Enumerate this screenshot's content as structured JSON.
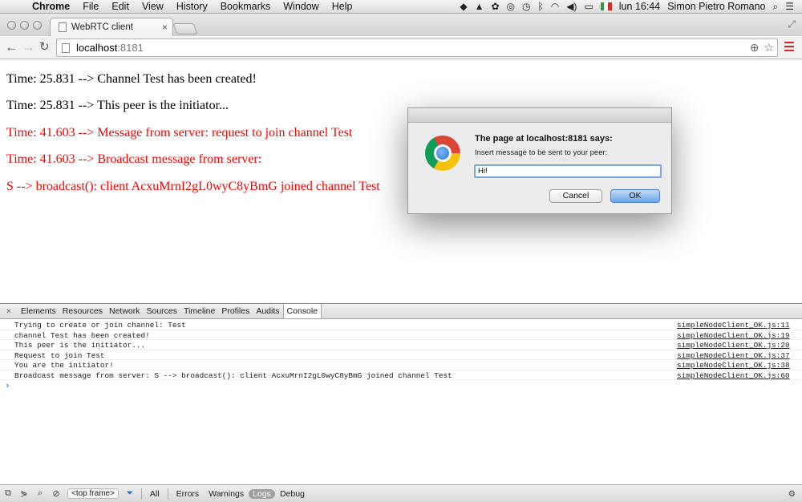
{
  "menubar": {
    "items": [
      "Chrome",
      "File",
      "Edit",
      "View",
      "History",
      "Bookmarks",
      "Window",
      "Help"
    ],
    "clock": "lun 16:44",
    "user": "Simon Pietro Romano"
  },
  "browser": {
    "tab_title": "WebRTC client",
    "url_host": "localhost",
    "url_port": ":8181"
  },
  "page": {
    "lines": [
      {
        "text": "Time: 25.831 --> Channel Test has been created!",
        "color": "#000000"
      },
      {
        "text": "Time: 25.831 --> This peer is the initiator...",
        "color": "#000000"
      },
      {
        "text": "Time: 41.603 --> Message from server: request to join channel Test",
        "color": "#ff0000"
      },
      {
        "text": "Time: 41.603 --> Broadcast message from server:",
        "color": "#ff0000"
      },
      {
        "text": "S --> broadcast(): client AcxuMrnI2gL0wyC8yBmG joined channel Test",
        "color": "#ff0000"
      }
    ]
  },
  "dialog": {
    "title": "The page at localhost:8181 says:",
    "message": "Insert message to be sent to your peer:",
    "input_value": "Hi!",
    "cancel_label": "Cancel",
    "ok_label": "OK"
  },
  "devtools": {
    "tabs": [
      "Elements",
      "Resources",
      "Network",
      "Sources",
      "Timeline",
      "Profiles",
      "Audits",
      "Console"
    ],
    "active_tab": "Console",
    "console_rows": [
      {
        "message": "Trying to create or join channel:  Test",
        "source": "simpleNodeClient_OK.js:11"
      },
      {
        "message": "channel Test has been created!",
        "source": "simpleNodeClient_OK.js:19"
      },
      {
        "message": "This peer is the initiator...",
        "source": "simpleNodeClient_OK.js:20"
      },
      {
        "message": "Request to join Test",
        "source": "simpleNodeClient_OK.js:37"
      },
      {
        "message": "You are the initiator!",
        "source": "simpleNodeClient_OK.js:38"
      },
      {
        "message": "Broadcast message from server: S --> broadcast(): client AcxuMrnI2gL0wyC8yBmG joined channel Test",
        "source": "simpleNodeClient_OK.js:60"
      }
    ],
    "prompt": "›",
    "frame_selector": "<top frame>",
    "filters": [
      "All",
      "Errors",
      "Warnings",
      "Logs",
      "Debug"
    ],
    "selected_filter": "Logs"
  }
}
